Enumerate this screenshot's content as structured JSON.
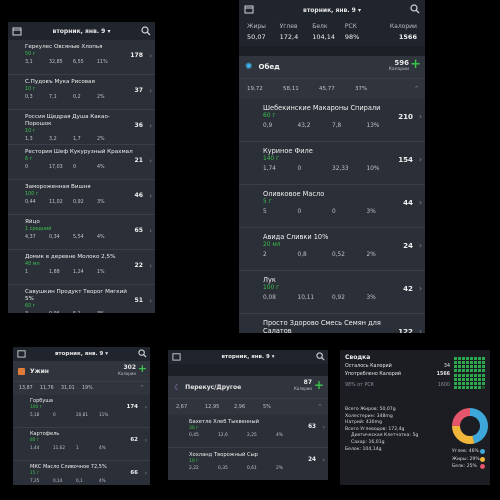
{
  "common": {
    "date": "вторник, янв. 9 ▾",
    "plus": "+",
    "chevron": "›",
    "chevron_up": "^"
  },
  "panel1": {
    "rows": [
      {
        "name": "Геркулес Овсяные Хлопья",
        "qty": "50 г",
        "cal": "178",
        "m": [
          "3,1",
          "32,85",
          "6,55",
          "11%"
        ]
      },
      {
        "name": "С.Пудовъ Мука Рисовая",
        "qty": "10 г",
        "cal": "37",
        "m": [
          "0,3",
          "7,1",
          "0,2",
          "2%"
        ]
      },
      {
        "name": "Россия Щедрая Душа Какао-Порошок",
        "qty": "10 г",
        "cal": "36",
        "m": [
          "1,3",
          "3,2",
          "1,7",
          "2%"
        ]
      },
      {
        "name": "Рестория Шеф Кукурузный Крахмал",
        "qty": "6 г",
        "cal": "21",
        "m": [
          "0",
          "17,03",
          "0",
          "4%"
        ]
      },
      {
        "name": "Замороженная Вишня",
        "qty": "100 г",
        "cal": "46",
        "m": [
          "0,44",
          "11,02",
          "0,92",
          "3%"
        ]
      },
      {
        "name": "Яйцо",
        "qty": "1 средний",
        "cal": "65",
        "m": [
          "4,37",
          "0,34",
          "5,54",
          "4%"
        ]
      },
      {
        "name": "Домик в деревне Молоко 2,5%",
        "qty": "40 мл",
        "cal": "22",
        "m": [
          "1",
          "1,88",
          "1,24",
          "1%"
        ]
      },
      {
        "name": "Савушкин Продукт Творог Мягкий 5%",
        "qty": "60 г",
        "cal": "51",
        "m": [
          "3",
          "0,96",
          "5,1",
          "3%"
        ]
      },
      {
        "name": "Zero Сироп Карамельный",
        "qty": "10 мл",
        "cal": "0",
        "m": [
          "0",
          "0",
          "0",
          "0%"
        ]
      }
    ]
  },
  "panel2": {
    "headers": [
      "Жиры",
      "Углев",
      "Белк",
      "РСК",
      "Калории"
    ],
    "values": [
      "50,07",
      "172,4",
      "104,14",
      "98%",
      "1566"
    ],
    "section": {
      "title": "Обед",
      "cal": "596",
      "cal_label": "Калории",
      "m": [
        "19,72",
        "58,11",
        "45,77",
        "37%"
      ]
    },
    "rows": [
      {
        "name": "Шебекинские Макароны Спирали",
        "qty": "60 г",
        "cal": "210",
        "m": [
          "0,9",
          "43,2",
          "7,8",
          "13%"
        ]
      },
      {
        "name": "Куриное Филе",
        "qty": "140 г",
        "cal": "154",
        "m": [
          "1,74",
          "0",
          "32,33",
          "10%"
        ]
      },
      {
        "name": "Оливковое Масло",
        "qty": "5 г",
        "cal": "44",
        "m": [
          "5",
          "0",
          "0",
          "3%"
        ]
      },
      {
        "name": "Авида Сливки 10%",
        "qty": "20 мл",
        "cal": "24",
        "m": [
          "2",
          "0,8",
          "0,52",
          "2%"
        ]
      },
      {
        "name": "Лук",
        "qty": "100 г",
        "cal": "42",
        "m": [
          "0,08",
          "10,11",
          "0,92",
          "3%"
        ]
      },
      {
        "name": "Просто Здорово Смесь Семян для Салатов",
        "qty": "",
        "cal": "122",
        "m": [
          "10",
          "4",
          "4,2",
          "8%"
        ]
      }
    ]
  },
  "panel3": {
    "section": {
      "title": "Ужин",
      "cal": "302",
      "cal_label": "Калории",
      "m": [
        "13,87",
        "11,76",
        "31,01",
        "19%"
      ]
    },
    "rows": [
      {
        "name": "Горбуша",
        "qty": "100 г",
        "cal": "174",
        "m": [
          "5,18",
          "0",
          "20,81",
          "11%"
        ]
      },
      {
        "name": "Картофель",
        "qty": "80 г",
        "cal": "62",
        "m": [
          "1,44",
          "11,62",
          "1",
          "4%"
        ]
      },
      {
        "name": "МКС Масло Сливочное 72,5%",
        "qty": "15 г",
        "cal": "66",
        "m": [
          "7,25",
          "0,14",
          "0,1",
          "4%"
        ]
      }
    ]
  },
  "panel4": {
    "section": {
      "title": "Перекус/Другое",
      "cal": "87",
      "cal_label": "Калории",
      "m": [
        "2,67",
        "12,95",
        "2,96",
        "5%"
      ]
    },
    "rows": [
      {
        "name": "Бахетле Хлеб Тыквенный",
        "qty": "30 г",
        "cal": "63",
        "m": [
          "0,45",
          "12,6",
          "2,25",
          "4%"
        ]
      },
      {
        "name": "Хохланд Творожный Сыр",
        "qty": "10 г",
        "cal": "24",
        "m": [
          "2,22",
          "0,35",
          "0,61",
          "2%"
        ]
      }
    ]
  },
  "panel5": {
    "title": "Сводка",
    "left_cal": {
      "label": "Осталось Калорий",
      "value": "34"
    },
    "used_cal": {
      "label": "Употреблено Калорий",
      "value": "1566"
    },
    "rsk": {
      "label": "98% от РСК",
      "value": "1600"
    },
    "grid": {
      "total": 64,
      "filled": 63
    },
    "lines": [
      "Всего Жиров: 50,07g",
      "Холестерин: 348mg",
      "Натрий: 430mg",
      "Всего Углеводов: 172,4g",
      "Диетическая Клетчатка: 5g",
      "Сахар: 16,01g",
      "Белок: 104,14g"
    ],
    "legend": [
      {
        "label": "Углев: 46%",
        "color": "#3da7dc",
        "pct": 46
      },
      {
        "label": "Жиры: 29%",
        "color": "#f1b73a",
        "pct": 29
      },
      {
        "label": "Белк: 25%",
        "color": "#e5556b",
        "pct": 25
      }
    ]
  }
}
